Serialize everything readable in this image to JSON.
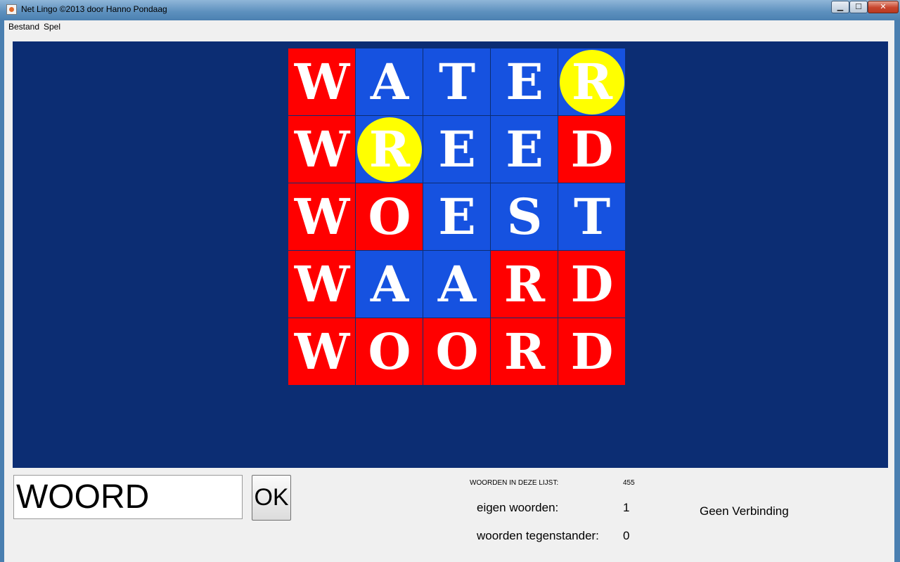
{
  "window": {
    "title": "Net Lingo ©2013 door Hanno Pondaag",
    "buttons": {
      "minimize": "▁",
      "maximize": "☐",
      "close": "✕"
    }
  },
  "menu": {
    "items": [
      "Bestand",
      "Spel"
    ]
  },
  "board": {
    "colors": {
      "background": "#0c2d73",
      "red": "#ff0000",
      "blue": "#1652e0",
      "yellow": "#ffff00"
    },
    "rows": [
      [
        {
          "letter": "W",
          "cell": "red"
        },
        {
          "letter": "A",
          "cell": "blue"
        },
        {
          "letter": "T",
          "cell": "blue"
        },
        {
          "letter": "E",
          "cell": "blue"
        },
        {
          "letter": "R",
          "cell": "blue",
          "circle": true
        }
      ],
      [
        {
          "letter": "W",
          "cell": "red"
        },
        {
          "letter": "R",
          "cell": "blue",
          "circle": true
        },
        {
          "letter": "E",
          "cell": "blue"
        },
        {
          "letter": "E",
          "cell": "blue"
        },
        {
          "letter": "D",
          "cell": "red"
        }
      ],
      [
        {
          "letter": "W",
          "cell": "red"
        },
        {
          "letter": "O",
          "cell": "red"
        },
        {
          "letter": "E",
          "cell": "blue"
        },
        {
          "letter": "S",
          "cell": "blue"
        },
        {
          "letter": "T",
          "cell": "blue"
        }
      ],
      [
        {
          "letter": "W",
          "cell": "red"
        },
        {
          "letter": "A",
          "cell": "blue"
        },
        {
          "letter": "A",
          "cell": "blue"
        },
        {
          "letter": "R",
          "cell": "red"
        },
        {
          "letter": "D",
          "cell": "red"
        }
      ],
      [
        {
          "letter": "W",
          "cell": "red"
        },
        {
          "letter": "O",
          "cell": "red"
        },
        {
          "letter": "O",
          "cell": "red"
        },
        {
          "letter": "R",
          "cell": "red"
        },
        {
          "letter": "D",
          "cell": "red"
        }
      ]
    ]
  },
  "input": {
    "value": "WOORD",
    "ok_label": "OK"
  },
  "stats": {
    "list_label": "WOORDEN IN DEZE LIJST:",
    "list_count": "455",
    "own_label": "eigen woorden:",
    "own_count": "1",
    "opponent_label": "woorden tegenstander:",
    "opponent_count": "0",
    "connection": "Geen Verbinding"
  }
}
